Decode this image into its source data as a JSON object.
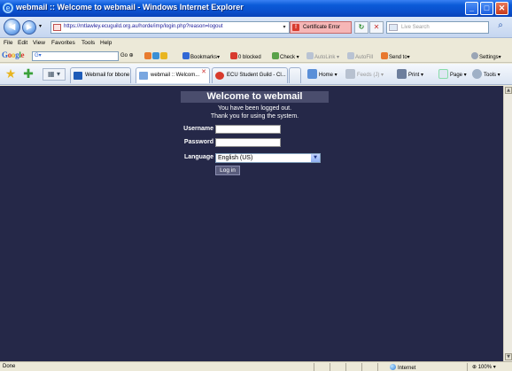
{
  "window": {
    "title": "webmail :: Welcome to webmail - Windows Internet Explorer",
    "icon": "ie-icon",
    "controls": {
      "minimize": "_",
      "maximize": "□",
      "close": "✕"
    }
  },
  "address_bar": {
    "url": "https://mtlawley.ecuguild.org.au/horde/imp/login.php?reason=logout",
    "certificate_error": "Certificate Error",
    "search_placeholder": "Live Search",
    "refresh_glyph": "↻",
    "stop_glyph": "✕",
    "search_glyph": "⌕",
    "dropdown_glyph": "▾"
  },
  "menu": {
    "items": [
      "File",
      "Edit",
      "View",
      "Favorites",
      "Tools",
      "Help"
    ]
  },
  "google_toolbar": {
    "logo": "Google",
    "search_value": "G▾",
    "go": "Go ⊕",
    "bookmarks": "Bookmarks▾",
    "blocked": "0 blocked",
    "check": "Check ▾",
    "autolink": "AutoLink ▾",
    "autofill": "AutoFill",
    "send_to": "Send to▾",
    "settings": "Settings▾",
    "colors": {
      "blue": "#3168d5",
      "red": "#d83b2e"
    }
  },
  "tabs": {
    "quick_tabs_glyph": "▦ ▾",
    "items": [
      {
        "label": "Webmail for bbone",
        "active": false,
        "icon_color": "#1d5bb8"
      },
      {
        "label": "webmail :: Welcom...",
        "active": true,
        "icon_color": "#7aa7e0"
      },
      {
        "label": "ECU Student Guild - Cl...",
        "active": false,
        "icon_color": "#d83b2e"
      }
    ],
    "close_glyph": "✕"
  },
  "command_bar": {
    "home": "Home ▾",
    "feeds": "Feeds (J) ▾",
    "print": "Print ▾",
    "page": "Page ▾",
    "tools": "Tools ▾"
  },
  "login": {
    "welcome": "Welcome to webmail",
    "logged_out": "You have been logged out.",
    "thanks": "Thank you for using the system.",
    "username_label": "Username",
    "username_value": "",
    "password_label": "Password",
    "password_value": "",
    "language_label": "Language",
    "language_value": "English (US)",
    "login_button": "Log in",
    "colors": {
      "background": "#252848",
      "header": "#4a4d6d"
    }
  },
  "statusbar": {
    "text": "Done",
    "zone": "Internet",
    "zoom": "100% ▾"
  }
}
